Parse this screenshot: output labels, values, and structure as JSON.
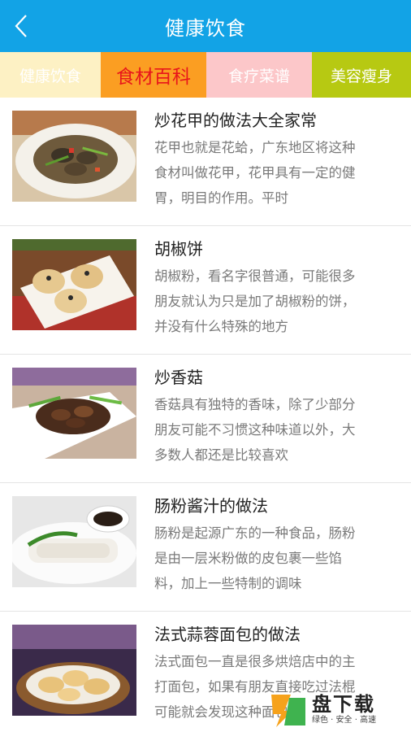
{
  "header": {
    "title": "健康饮食",
    "back_icon": "chevron-left-icon"
  },
  "tabs": [
    {
      "label": "健康饮食",
      "selected": false
    },
    {
      "label": "食材百科",
      "selected": true
    },
    {
      "label": "食疗菜谱",
      "selected": false
    },
    {
      "label": "美容瘦身",
      "selected": false
    }
  ],
  "colors": {
    "header": "#12a3e6",
    "tab_active_text": "#e8161b"
  },
  "articles": [
    {
      "title": "炒花甲的做法大全家常",
      "lines": [
        "花甲也就是花蛤，广东地区将这种",
        "食材叫做花甲，花甲具有一定的健",
        "胃，明目的作用。平时"
      ]
    },
    {
      "title": "胡椒饼",
      "lines": [
        "胡椒粉，看名字很普通，可能很多",
        "朋友就认为只是加了胡椒粉的饼，",
        "并没有什么特殊的地方"
      ]
    },
    {
      "title": "炒香菇",
      "lines": [
        "香菇具有独特的香味，除了少部分",
        "朋友可能不习惯这种味道以外，大",
        "多数人都还是比较喜欢"
      ]
    },
    {
      "title": "肠粉酱汁的做法",
      "lines": [
        "肠粉是起源广东的一种食品，肠粉",
        "是由一层米粉做的皮包裹一些馅",
        "料，加上一些特制的调味"
      ]
    },
    {
      "title": "法式蒜蓉面包的做法",
      "lines": [
        "法式面包一直是很多烘焙店中的主",
        "打面包，如果有朋友直接吃过法棍",
        "可能就会发现这种面包"
      ]
    }
  ],
  "watermark": {
    "main": "盘下载",
    "sub": "绿色 · 安全 · 高速"
  }
}
